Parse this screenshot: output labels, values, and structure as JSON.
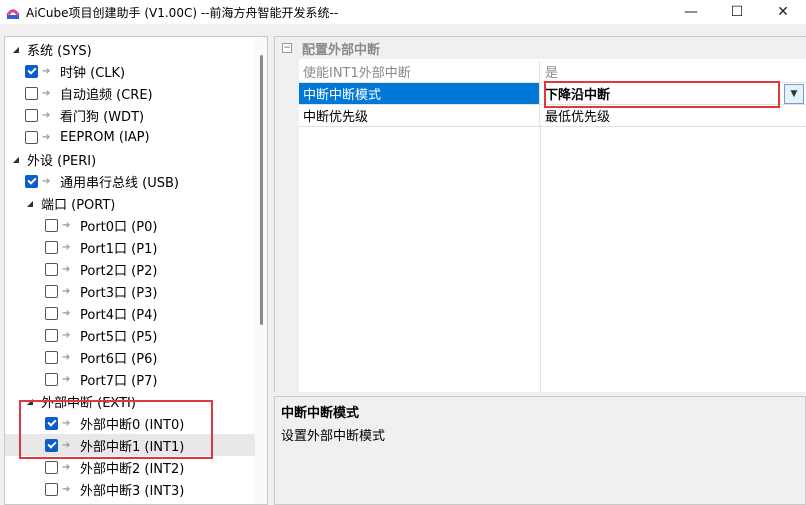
{
  "window": {
    "title": "AiCube项目创建助手 (V1.00C) --前海方舟智能开发系统--",
    "minimize": "—",
    "maximize": "☐",
    "close": "✕"
  },
  "tree": {
    "items": [
      {
        "label": "系统 (SYS)",
        "level": 0,
        "expander": "◢"
      },
      {
        "label": "时钟 (CLK)",
        "level": 1,
        "checked": true
      },
      {
        "label": "自动追频 (CRE)",
        "level": 1,
        "checked": false
      },
      {
        "label": "看门狗 (WDT)",
        "level": 1,
        "checked": false
      },
      {
        "label": "EEPROM (IAP)",
        "level": 1,
        "checked": false
      },
      {
        "label": "外设 (PERI)",
        "level": 0,
        "expander": "◢"
      },
      {
        "label": "通用串行总线 (USB)",
        "level": 1,
        "checked": true
      },
      {
        "label": "端口 (PORT)",
        "level": 1,
        "expander": "◢"
      },
      {
        "label": "Port0口 (P0)",
        "level": 2,
        "checked": false
      },
      {
        "label": "Port1口 (P1)",
        "level": 2,
        "checked": false
      },
      {
        "label": "Port2口 (P2)",
        "level": 2,
        "checked": false
      },
      {
        "label": "Port3口 (P3)",
        "level": 2,
        "checked": false
      },
      {
        "label": "Port4口 (P4)",
        "level": 2,
        "checked": false
      },
      {
        "label": "Port5口 (P5)",
        "level": 2,
        "checked": false
      },
      {
        "label": "Port6口 (P6)",
        "level": 2,
        "checked": false
      },
      {
        "label": "Port7口 (P7)",
        "level": 2,
        "checked": false
      },
      {
        "label": "外部中断 (EXTI)",
        "level": 1,
        "expander": "◢"
      },
      {
        "label": "外部中断0 (INT0)",
        "level": 2,
        "checked": true
      },
      {
        "label": "外部中断1 (INT1)",
        "level": 2,
        "checked": true,
        "selected": true
      },
      {
        "label": "外部中断2 (INT2)",
        "level": 2,
        "checked": false
      },
      {
        "label": "外部中断3 (INT3)",
        "level": 2,
        "checked": false
      }
    ]
  },
  "grid": {
    "category": "配置外部中断",
    "category_toggle": "−",
    "rows": [
      {
        "name": "使能INT1外部中断",
        "value": "是"
      },
      {
        "name": "中断中断模式",
        "value": "下降沿中断"
      },
      {
        "name": "中断优先级",
        "value": "最低优先级"
      }
    ],
    "dropdown_icon": "▼"
  },
  "description": {
    "title": "中断中断模式",
    "text": "设置外部中断模式"
  },
  "colors": {
    "selection": "#0078d7",
    "checkbox": "#0b5ccd",
    "highlight": "#e0383e"
  }
}
